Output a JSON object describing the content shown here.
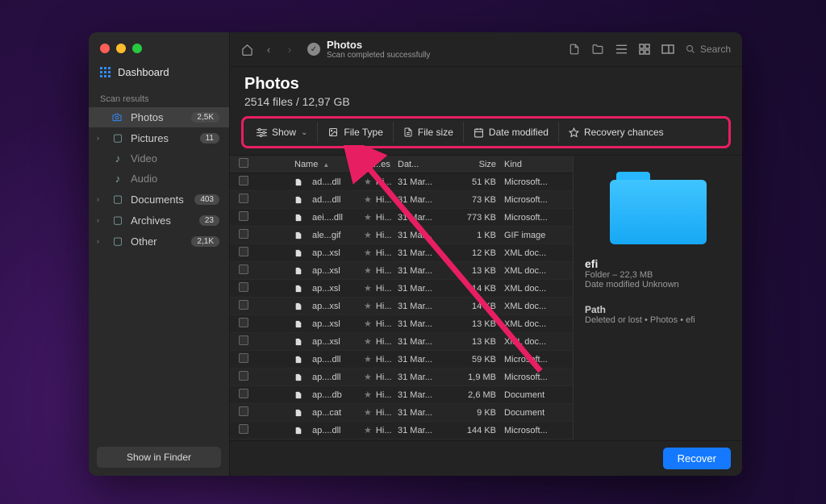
{
  "sidebar": {
    "dashboard_label": "Dashboard",
    "section_label": "Scan results",
    "items": [
      {
        "label": "Photos",
        "badge": "2,5K",
        "selected": true,
        "sub": false,
        "expandable": false
      },
      {
        "label": "Pictures",
        "badge": "11",
        "selected": false,
        "sub": false,
        "expandable": true
      },
      {
        "label": "Video",
        "badge": "",
        "selected": false,
        "sub": true,
        "expandable": false
      },
      {
        "label": "Audio",
        "badge": "",
        "selected": false,
        "sub": true,
        "expandable": false
      },
      {
        "label": "Documents",
        "badge": "403",
        "selected": false,
        "sub": false,
        "expandable": true
      },
      {
        "label": "Archives",
        "badge": "23",
        "selected": false,
        "sub": false,
        "expandable": true
      },
      {
        "label": "Other",
        "badge": "2,1K",
        "selected": false,
        "sub": false,
        "expandable": true
      }
    ],
    "show_in_finder": "Show in Finder"
  },
  "toolbar": {
    "title": "Photos",
    "subtitle": "Scan completed successfully",
    "search_placeholder": "Search"
  },
  "header": {
    "title": "Photos",
    "subtitle": "2514 files / 12,97 GB"
  },
  "filters": {
    "show": "Show",
    "file_type": "File Type",
    "file_size": "File size",
    "date_modified": "Date modified",
    "recovery_chances": "Recovery chances"
  },
  "columns": {
    "name": "Name",
    "recoverable": "Re...es",
    "date": "Dat...",
    "size": "Size",
    "kind": "Kind"
  },
  "rows": [
    {
      "name": "ad....dll",
      "rec": "Hi...",
      "date": "31 Mar...",
      "size": "51 KB",
      "kind": "Microsoft..."
    },
    {
      "name": "ad....dll",
      "rec": "Hi...",
      "date": "31 Mar...",
      "size": "73 KB",
      "kind": "Microsoft..."
    },
    {
      "name": "aei....dll",
      "rec": "Hi...",
      "date": "31 Mar...",
      "size": "773 KB",
      "kind": "Microsoft..."
    },
    {
      "name": "ale...gif",
      "rec": "Hi...",
      "date": "31 Mar...",
      "size": "1 KB",
      "kind": "GIF image"
    },
    {
      "name": "ap...xsl",
      "rec": "Hi...",
      "date": "31 Mar...",
      "size": "12 KB",
      "kind": "XML doc..."
    },
    {
      "name": "ap...xsl",
      "rec": "Hi...",
      "date": "31 Mar...",
      "size": "13 KB",
      "kind": "XML doc..."
    },
    {
      "name": "ap...xsl",
      "rec": "Hi...",
      "date": "31 Mar...",
      "size": "14 KB",
      "kind": "XML doc..."
    },
    {
      "name": "ap...xsl",
      "rec": "Hi...",
      "date": "31 Mar...",
      "size": "14 KB",
      "kind": "XML doc..."
    },
    {
      "name": "ap...xsl",
      "rec": "Hi...",
      "date": "31 Mar...",
      "size": "13 KB",
      "kind": "XML doc..."
    },
    {
      "name": "ap...xsl",
      "rec": "Hi...",
      "date": "31 Mar...",
      "size": "13 KB",
      "kind": "XML doc..."
    },
    {
      "name": "ap....dll",
      "rec": "Hi...",
      "date": "31 Mar...",
      "size": "59 KB",
      "kind": "Microsoft..."
    },
    {
      "name": "ap....dll",
      "rec": "Hi...",
      "date": "31 Mar...",
      "size": "1,9 MB",
      "kind": "Microsoft..."
    },
    {
      "name": "ap....db",
      "rec": "Hi...",
      "date": "31 Mar...",
      "size": "2,6 MB",
      "kind": "Document"
    },
    {
      "name": "ap...cat",
      "rec": "Hi...",
      "date": "31 Mar...",
      "size": "9 KB",
      "kind": "Document"
    },
    {
      "name": "ap....dll",
      "rec": "Hi...",
      "date": "31 Mar...",
      "size": "144 KB",
      "kind": "Microsoft..."
    }
  ],
  "inspector": {
    "name": "efi",
    "meta": "Folder – 22,3 MB",
    "date_label": "Date modified",
    "date_value": "Unknown",
    "path_label": "Path",
    "path_value": "Deleted or lost • Photos • efi"
  },
  "footer": {
    "recover": "Recover"
  }
}
